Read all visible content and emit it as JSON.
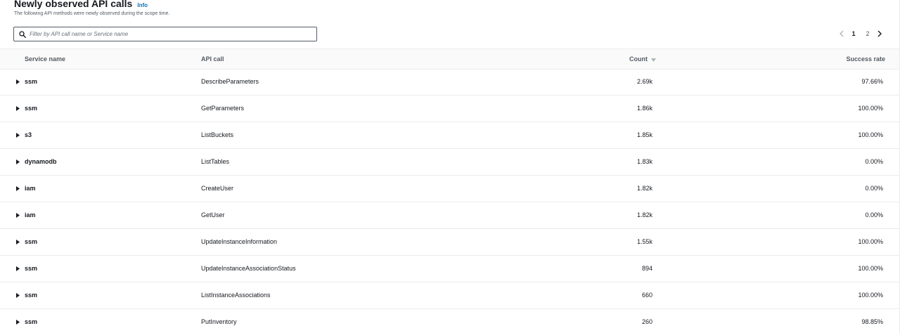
{
  "header": {
    "title": "Newly observed API calls",
    "info_label": "Info",
    "subtitle": "The following API methods were newly observed during the scope time."
  },
  "search": {
    "placeholder": "Filter by API call name or Service name",
    "value": ""
  },
  "pagination": {
    "pages": [
      "1",
      "2"
    ],
    "current_page": "1"
  },
  "table": {
    "columns": {
      "service": "Service name",
      "api": "API call",
      "count": "Count",
      "rate": "Success rate"
    },
    "sorted_column": "count",
    "sort_direction": "descending",
    "rows": [
      {
        "service": "ssm",
        "api": "DescribeParameters",
        "count": "2.69k",
        "rate": "97.66%"
      },
      {
        "service": "ssm",
        "api": "GetParameters",
        "count": "1.86k",
        "rate": "100.00%"
      },
      {
        "service": "s3",
        "api": "ListBuckets",
        "count": "1.85k",
        "rate": "100.00%"
      },
      {
        "service": "dynamodb",
        "api": "ListTables",
        "count": "1.83k",
        "rate": "0.00%"
      },
      {
        "service": "iam",
        "api": "CreateUser",
        "count": "1.82k",
        "rate": "0.00%"
      },
      {
        "service": "iam",
        "api": "GetUser",
        "count": "1.82k",
        "rate": "0.00%"
      },
      {
        "service": "ssm",
        "api": "UpdateInstanceInformation",
        "count": "1.55k",
        "rate": "100.00%"
      },
      {
        "service": "ssm",
        "api": "UpdateInstanceAssociationStatus",
        "count": "894",
        "rate": "100.00%"
      },
      {
        "service": "ssm",
        "api": "ListInstanceAssociations",
        "count": "660",
        "rate": "100.00%"
      },
      {
        "service": "ssm",
        "api": "PutInventory",
        "count": "260",
        "rate": "98.85%"
      }
    ]
  },
  "icons": {
    "search": "search-icon",
    "expand": "caret-right-icon",
    "sort": "sort-descending-icon",
    "prev": "chevron-left-icon",
    "next": "chevron-right-icon"
  },
  "colors": {
    "link": "#0073bb",
    "text": "#16191f",
    "muted": "#545b64",
    "border": "#eaeded"
  }
}
